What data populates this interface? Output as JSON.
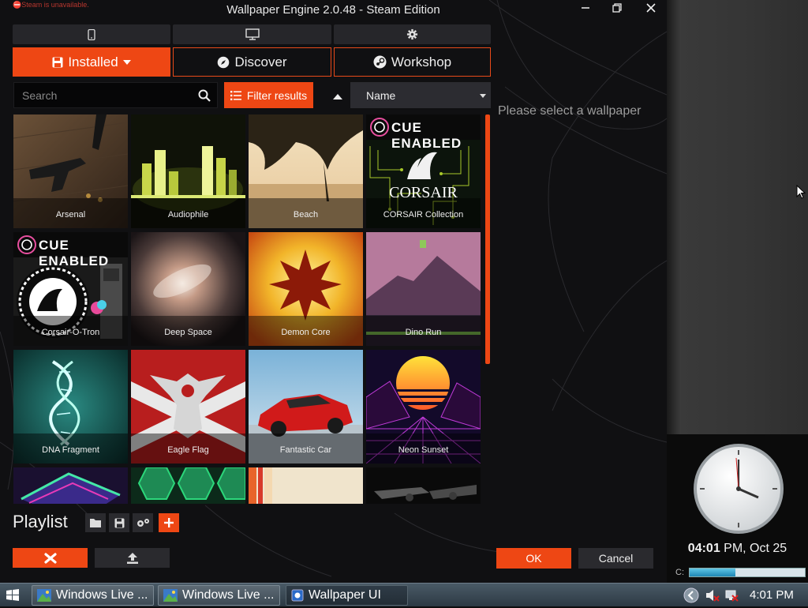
{
  "window": {
    "steam_warning": "Steam is unavailable.",
    "title": "Wallpaper Engine 2.0.48 - Steam Edition"
  },
  "device_tabs": [
    "phone-icon",
    "monitor-icon",
    "gear-icon"
  ],
  "nav_tabs": [
    {
      "label": "Installed",
      "icon": "save-icon"
    },
    {
      "label": "Discover",
      "icon": "compass-icon"
    },
    {
      "label": "Workshop",
      "icon": "steam-icon"
    }
  ],
  "search": {
    "placeholder": "Search"
  },
  "filter": {
    "label": "Filter results"
  },
  "sort": {
    "value": "Name"
  },
  "status_message": "Please select a wallpaper",
  "wallpapers": [
    {
      "name": "Arsenal"
    },
    {
      "name": "Audiophile"
    },
    {
      "name": "Beach"
    },
    {
      "name": "CORSAIR Collection",
      "badge": "CUE ENABLED",
      "brand": "CORSAIR"
    },
    {
      "name": "Corsair-O-Tron",
      "badge": "CUE ENABLED"
    },
    {
      "name": "Deep Space"
    },
    {
      "name": "Demon Core"
    },
    {
      "name": "Dino Run"
    },
    {
      "name": "DNA Fragment"
    },
    {
      "name": "Eagle Flag"
    },
    {
      "name": "Fantastic Car"
    },
    {
      "name": "Neon Sunset"
    },
    {
      "name": ""
    },
    {
      "name": ""
    },
    {
      "name": ""
    },
    {
      "name": ""
    }
  ],
  "playlist": {
    "label": "Playlist"
  },
  "buttons": {
    "ok": "OK",
    "cancel": "Cancel"
  },
  "desktop": {
    "clock_time": "04:01",
    "clock_suffix": " PM, Oct 25",
    "drive_label": "C:",
    "drive_usage": 0.4
  },
  "taskbar": {
    "items": [
      "Windows Live ...",
      "Windows Live ...",
      "Wallpaper UI"
    ],
    "time": "4:01 PM"
  },
  "colors": {
    "accent": "#ee4714",
    "panel": "#2a2a2e",
    "background": "#101012"
  }
}
